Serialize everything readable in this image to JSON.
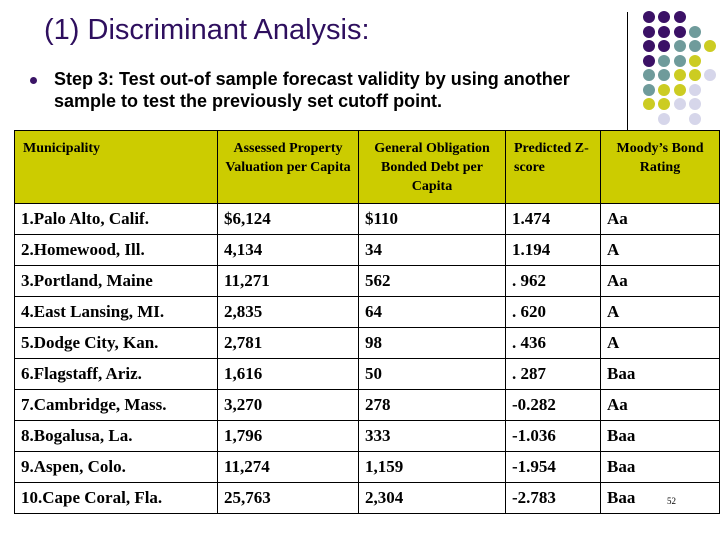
{
  "slide": {
    "title": "(1)  Discriminant Analysis:",
    "bullet": "Step 3: Test out-of sample forecast validity by using another sample to test the previously set cutoff point.",
    "page_number": "52",
    "colors": {
      "title": "#2e0f5e",
      "header_fill": "#cccc00",
      "dot_purple": "#3b1166",
      "dot_teal": "#6f9b9b",
      "dot_yellow": "#cccc22",
      "dot_lavender": "#d6d6ea"
    }
  },
  "table": {
    "headers": [
      "Municipality",
      "Assessed Property Valuation per Capita",
      "General Obligation Bonded Debt per Capita",
      "Predicted Z-score",
      "Moody’s Bond Rating"
    ],
    "rows": [
      [
        "1.Palo Alto, Calif.",
        "$6,124",
        "$110",
        "1.474",
        "Aa"
      ],
      [
        "2.Homewood, Ill.",
        "4,134",
        "34",
        "1.194",
        "A"
      ],
      [
        "3.Portland, Maine",
        "11,271",
        "562",
        ". 962",
        "Aa"
      ],
      [
        "4.East Lansing, MI.",
        "2,835",
        "64",
        ". 620",
        "A"
      ],
      [
        "5.Dodge City, Kan.",
        "2,781",
        "98",
        ". 436",
        "A"
      ],
      [
        "6.Flagstaff, Ariz.",
        "1,616",
        "50",
        ". 287",
        "Baa"
      ],
      [
        "7.Cambridge, Mass.",
        "3,270",
        "278",
        "-0.282",
        "Aa"
      ],
      [
        "8.Bogalusa, La.",
        "1,796",
        "333",
        "-1.036",
        "Baa"
      ],
      [
        "9.Aspen, Colo.",
        "11,274",
        "1,159",
        "-1.954",
        "Baa"
      ],
      [
        "10.Cape Coral, Fla.",
        "25,763",
        "2,304",
        "-2.783",
        "Baa"
      ]
    ]
  }
}
